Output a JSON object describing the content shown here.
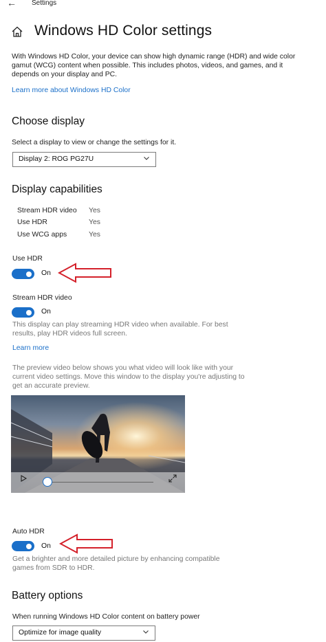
{
  "topbar": {
    "back_glyph": "←",
    "title": "Settings"
  },
  "page_title": "Windows HD Color settings",
  "intro": {
    "text": "With Windows HD Color, your device can show high dynamic range (HDR) and wide color gamut (WCG) content when possible. This includes photos, videos, and games, and it depends on your display and PC.",
    "link": "Learn more about Windows HD Color"
  },
  "choose_display": {
    "heading": "Choose display",
    "description": "Select a display to view or change the settings for it.",
    "selected": "Display 2: ROG PG27U"
  },
  "capabilities": {
    "heading": "Display capabilities",
    "rows": [
      {
        "name": "Stream HDR video",
        "value": "Yes"
      },
      {
        "name": "Use HDR",
        "value": "Yes"
      },
      {
        "name": "Use WCG apps",
        "value": "Yes"
      }
    ]
  },
  "use_hdr": {
    "label": "Use HDR",
    "state": "On"
  },
  "stream_hdr": {
    "label": "Stream HDR video",
    "state": "On",
    "description": "This display can play streaming HDR video when available. For best results, play HDR videos full screen.",
    "link": "Learn more"
  },
  "preview": {
    "description": "The preview video below shows you what video will look like with your current video settings. Move this window to the display you're adjusting to get an accurate preview.",
    "progress": 0.05
  },
  "auto_hdr": {
    "label": "Auto HDR",
    "state": "On",
    "description": "Get a brighter and more detailed picture by enhancing compatible games from SDR to HDR."
  },
  "battery": {
    "heading": "Battery options",
    "description": "When running Windows HD Color content on battery power",
    "selected": "Optimize for image quality"
  },
  "colors": {
    "accent": "#1a6fc9",
    "arrow": "#d4202a"
  }
}
